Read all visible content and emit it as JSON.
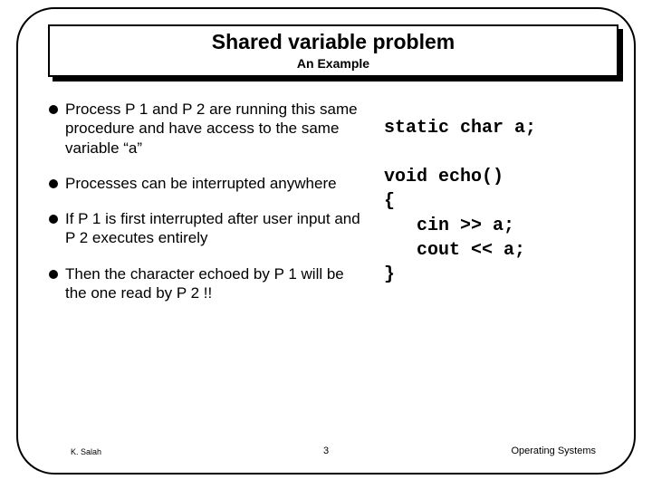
{
  "title": {
    "main": "Shared variable problem",
    "sub": "An Example"
  },
  "bullets": [
    "Process P 1 and P 2 are running this same procedure and have access to the same variable “a”",
    "Processes can be interrupted anywhere",
    "If P 1 is first interrupted after user input and P 2 executes entirely",
    "Then the character echoed by P 1 will be the one read by P 2 !!"
  ],
  "code": "static char a;\n\nvoid echo()\n{\n   cin >> a;\n   cout << a;\n}",
  "footer": {
    "left": "K. Salah",
    "center": "3",
    "right": "Operating Systems"
  }
}
